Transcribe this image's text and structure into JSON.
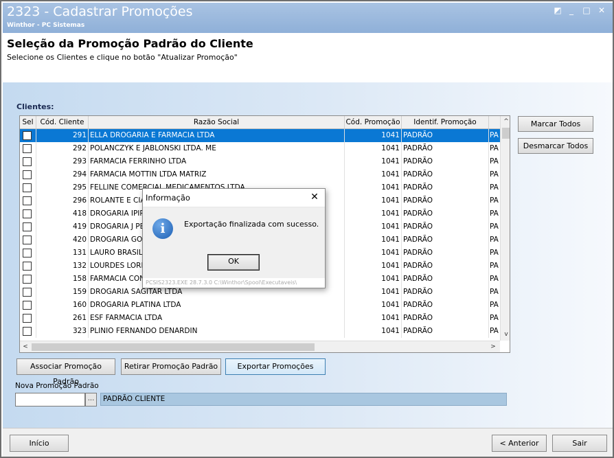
{
  "window": {
    "title": "2323 - Cadastrar Promoções",
    "subtitle": "Winthor - PC Sistemas",
    "controls": {
      "restore": "◩",
      "minimize": "_",
      "maximize": "□",
      "close": "✕"
    }
  },
  "header": {
    "title": "Seleção da Promoção Padrão do Cliente",
    "instructions": "Selecione os Clientes e clique no botão \"Atualizar Promoção\""
  },
  "clients": {
    "label": "Clientes:",
    "columns": [
      "Sel",
      "Cód. Cliente",
      "Razão Social",
      "Cód. Promoção",
      "Identif. Promoção"
    ],
    "rows": [
      {
        "cod": "291",
        "razao": "ELLA DROGARIA E FARMACIA LTDA",
        "codPromo": "1041",
        "identif": "PADRÃO",
        "extra": "PA",
        "selected": true
      },
      {
        "cod": "292",
        "razao": "POLANCZYK E JABLONSKI LTDA. ME",
        "codPromo": "1041",
        "identif": "PADRÃO",
        "extra": "PA"
      },
      {
        "cod": "293",
        "razao": "FARMACIA FERRINHO LTDA",
        "codPromo": "1041",
        "identif": "PADRÃO",
        "extra": "PA"
      },
      {
        "cod": "294",
        "razao": "FARMACIA MOTTIN LTDA MATRIZ",
        "codPromo": "1041",
        "identif": "PADRÃO",
        "extra": "PA"
      },
      {
        "cod": "295",
        "razao": "FELLINE COMERCIAL MEDICAMENTOS LTDA",
        "codPromo": "1041",
        "identif": "PADRÃO",
        "extra": "PA"
      },
      {
        "cod": "296",
        "razao": "ROLANTE E CIA",
        "codPromo": "1041",
        "identif": "PADRÃO",
        "extra": "PA"
      },
      {
        "cod": "418",
        "razao": "DROGARIA IPIR",
        "codPromo": "1041",
        "identif": "PADRÃO",
        "extra": "PA"
      },
      {
        "cod": "419",
        "razao": "DROGARIA J PE",
        "codPromo": "1041",
        "identif": "PADRÃO",
        "extra": "PA"
      },
      {
        "cod": "420",
        "razao": "DROGARIA GOL",
        "codPromo": "1041",
        "identif": "PADRÃO",
        "extra": "PA"
      },
      {
        "cod": "131",
        "razao": "LAURO BRASIL E",
        "codPromo": "1041",
        "identif": "PADRÃO",
        "extra": "PA"
      },
      {
        "cod": "132",
        "razao": "LOURDES LOREN",
        "codPromo": "1041",
        "identif": "PADRÃO",
        "extra": "PA"
      },
      {
        "cod": "158",
        "razao": "FARMACIA CON",
        "codPromo": "1041",
        "identif": "PADRÃO",
        "extra": "PA"
      },
      {
        "cod": "159",
        "razao": "DROGARIA SAGITAR LTDA",
        "codPromo": "1041",
        "identif": "PADRÃO",
        "extra": "PA"
      },
      {
        "cod": "160",
        "razao": "DROGARIA PLATINA LTDA",
        "codPromo": "1041",
        "identif": "PADRÃO",
        "extra": "PA"
      },
      {
        "cod": "261",
        "razao": "ESF FARMACIA LTDA",
        "codPromo": "1041",
        "identif": "PADRÃO",
        "extra": "PA"
      },
      {
        "cod": "323",
        "razao": "PLINIO FERNANDO DENARDIN",
        "codPromo": "1041",
        "identif": "PADRÃO",
        "extra": "PA"
      }
    ]
  },
  "scroll": {
    "up": "^",
    "down": "v",
    "left": "<",
    "right": ">"
  },
  "side_buttons": {
    "marcar": "Marcar Todos",
    "desmarcar": "Desmarcar Todos"
  },
  "actions": {
    "associar": "Associar Promoção Padrão",
    "retirar": "Retirar Promoção Padrão",
    "exportar": "Exportar Promoções"
  },
  "nova_promocao": {
    "label": "Nova Promoção Padrão",
    "value": "",
    "lookup": "...",
    "description": "PADRÃO CLIENTE"
  },
  "footer": {
    "inicio": "Início",
    "anterior": "< Anterior",
    "sair": "Sair"
  },
  "dialog": {
    "title": "Informação",
    "close": "✕",
    "icon": "i",
    "message": "Exportação finalizada com sucesso.",
    "ok": "OK",
    "status": "PCSIS2323.EXE 28.7.3.0 C:\\Winthor\\Spool\\Executaveis\\"
  }
}
